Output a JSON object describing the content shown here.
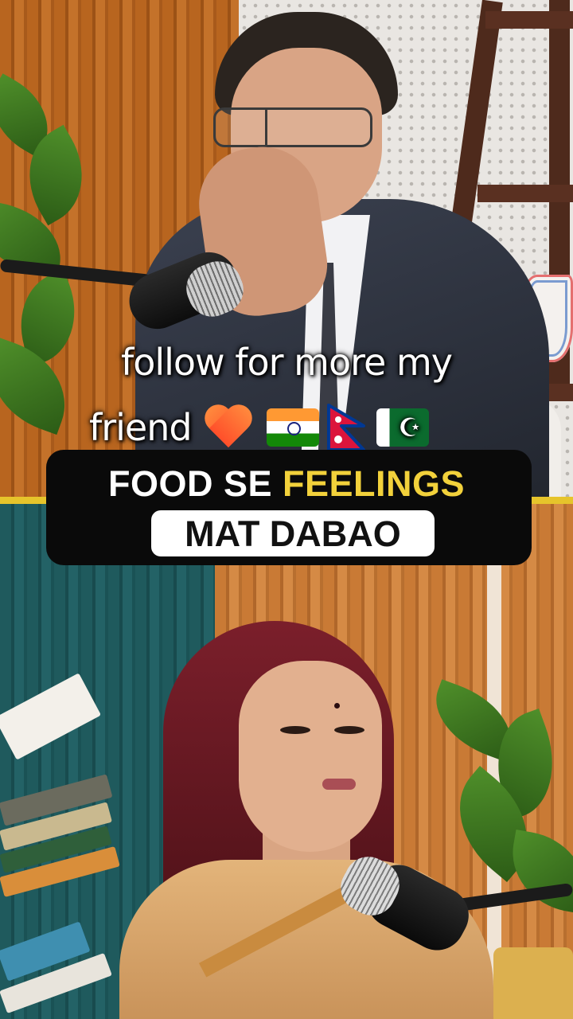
{
  "caption": {
    "line1": "follow for more my",
    "line2": "friend",
    "emoji": [
      "orange-heart-icon",
      "india-flag-icon",
      "nepal-flag-icon",
      "pakistan-flag-icon"
    ]
  },
  "title": {
    "line1_part1": "FOOD SE",
    "line1_highlight": "FEELINGS",
    "line2": "MAT DABAO"
  },
  "colors": {
    "title_highlight": "#f2d13b",
    "banner_bg": "#0a0a0a",
    "divider": "#e6c42b"
  }
}
